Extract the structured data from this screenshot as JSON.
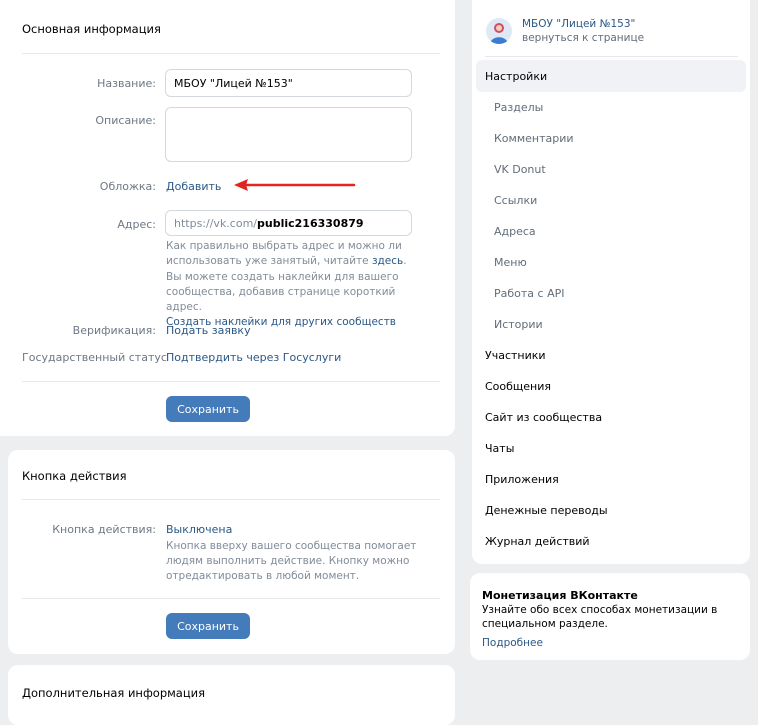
{
  "header": {
    "group_name": "МБОУ \"Лицей №153\"",
    "back_link": "вернуться к странице"
  },
  "main": {
    "section_title": "Основная информация",
    "name_label": "Название:",
    "name_value": "МБОУ \"Лицей №153\"",
    "description_label": "Описание:",
    "description_value": "",
    "cover_label": "Обложка:",
    "cover_link": "Добавить",
    "address_label": "Адрес:",
    "address_prefix": "https://vk.com/",
    "address_value": "public216330879",
    "address_hint_1": "Как правильно выбрать адрес и можно ли использовать уже занятый, читайте",
    "address_hint_link": "здесь",
    "address_hint_2": "Вы можете создать наклейки для вашего сообщества, добавив странице короткий адрес.",
    "stickers_link": "Создать наклейки для других сообществ",
    "verification_label": "Верификация:",
    "verification_link": "Подать заявку",
    "gov_status_label": "Государственный статус",
    "gov_status_link": "Подтвердить через Госуслуги",
    "save_label": "Сохранить"
  },
  "action": {
    "section_title": "Кнопка действия",
    "label": "Кнопка действия:",
    "value": "Выключена",
    "hint": "Кнопка вверху вашего сообщества помогает людям выполнить действие. Кнопку можно отредактировать в любой момент.",
    "save_label": "Сохранить"
  },
  "extra": {
    "section_title": "Дополнительная информация"
  },
  "nav": {
    "settings": "Настройки",
    "sub_items": [
      "Разделы",
      "Комментарии",
      "VK Donut",
      "Ссылки",
      "Адреса",
      "Меню",
      "Работа с API",
      "Истории"
    ],
    "items": [
      "Участники",
      "Сообщения",
      "Сайт из сообщества",
      "Чаты",
      "Приложения",
      "Денежные переводы",
      "Журнал действий"
    ]
  },
  "promo": {
    "title": "Монетизация ВКонтакте",
    "text": "Узнайте обо всех способах монетизации в специальном разделе.",
    "link": "Подробнее"
  },
  "colors": {
    "accent": "#447bba",
    "link": "#2a5885",
    "annotation_arrow": "#e0261d"
  }
}
